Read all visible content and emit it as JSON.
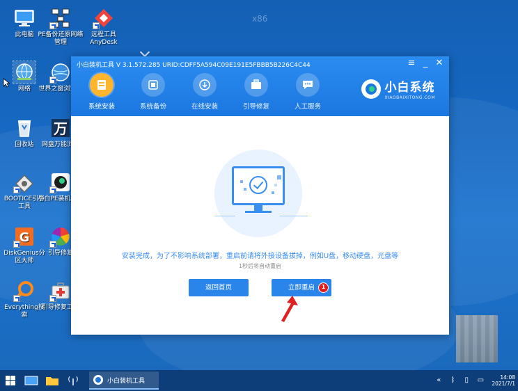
{
  "desktop": {
    "watermark": "x86",
    "icons": [
      {
        "label": "此电脑"
      },
      {
        "label": "PE备份还原网络管理"
      },
      {
        "label": "远程工具AnyDesk"
      },
      {
        "label": "网络"
      },
      {
        "label": "世界之窗浏览器"
      },
      {
        "label": "回收站"
      },
      {
        "label": "网盘万能浏览"
      },
      {
        "label": "BOOTICE引导工具"
      },
      {
        "label": "小白PE装机工具"
      },
      {
        "label": "DiskGenius分区大师"
      },
      {
        "label": "引导修复"
      },
      {
        "label": "Everything搜索"
      },
      {
        "label": "引导修复工具"
      }
    ]
  },
  "window": {
    "title": "小白装机工具 V 3.1.572.285 URID:CDFF5A594C09E191E5FBBB5B226C4C44",
    "controls": {
      "menu": "≡",
      "minimize": "_",
      "close": "✕"
    },
    "nav": [
      {
        "label": "系统安装",
        "active": true
      },
      {
        "label": "系统备份",
        "active": false
      },
      {
        "label": "在线安装",
        "active": false
      },
      {
        "label": "引导修复",
        "active": false
      },
      {
        "label": "人工服务",
        "active": false
      }
    ],
    "logo": {
      "name": "小白系统",
      "domain": "XIAOBAIXITONG.COM"
    },
    "message": "安装完成，为了不影响系统部署，重启前请将外接设备拔掉，例如U盘，移动硬盘，光盘等",
    "countdown": "1秒后将自动重启",
    "buttons": {
      "home": "返回首页",
      "restart": "立即重启"
    },
    "badge": "1"
  },
  "taskbar": {
    "app_label": "小白装机工具",
    "clock_time": "14:08",
    "clock_date": "2021/7/1"
  },
  "colors": {
    "accent": "#2a85ea",
    "titlebar": "#1b77e0",
    "active_nav": "#ffb52e",
    "badge": "#e01f1f"
  }
}
